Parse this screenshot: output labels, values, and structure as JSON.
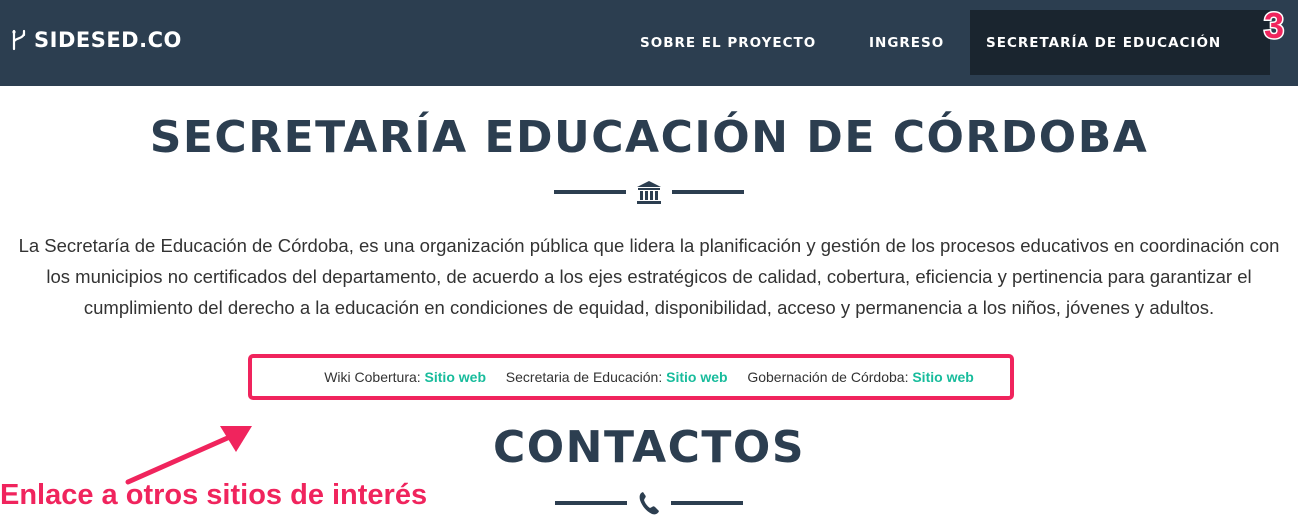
{
  "navbar": {
    "brand": "SIDESED.CO",
    "items": [
      {
        "label": "SOBRE EL PROYECTO"
      },
      {
        "label": "INGRESO"
      },
      {
        "label": "SECRETARÍA DE EDUCACIÓN"
      }
    ]
  },
  "annotation_number": "3",
  "main": {
    "title": "SECRETARÍA EDUCACIÓN DE CÓRDOBA",
    "description": "La Secretaría de Educación de Córdoba, es una organización pública que lidera la planificación y gestión de los procesos educativos en coordinación con los municipios no certificados del departamento, de acuerdo a los ejes estratégicos de calidad, cobertura, eficiencia y pertinencia para garantizar el cumplimiento del derecho a la educación en condiciones de equidad, disponibilidad, acceso y permanencia a los niños, jóvenes y adultos.",
    "links": [
      {
        "label": "Wiki Cobertura:",
        "link_text": "Sitio web"
      },
      {
        "label": "Secretaria de Educación:",
        "link_text": "Sitio web"
      },
      {
        "label": "Gobernación de Córdoba:",
        "link_text": "Sitio web"
      }
    ],
    "contacts_title": "CONTACTOS"
  },
  "annotation": {
    "text": "Enlace a otros sitios de interés"
  },
  "colors": {
    "navbar": "#2c3e50",
    "active_nav": "#1a252f",
    "link": "#18bc9c",
    "annotation": "#f0245d"
  },
  "icons": {
    "brand": "branch-icon",
    "title_divider": "institution-icon",
    "contact_divider": "phone-icon"
  }
}
